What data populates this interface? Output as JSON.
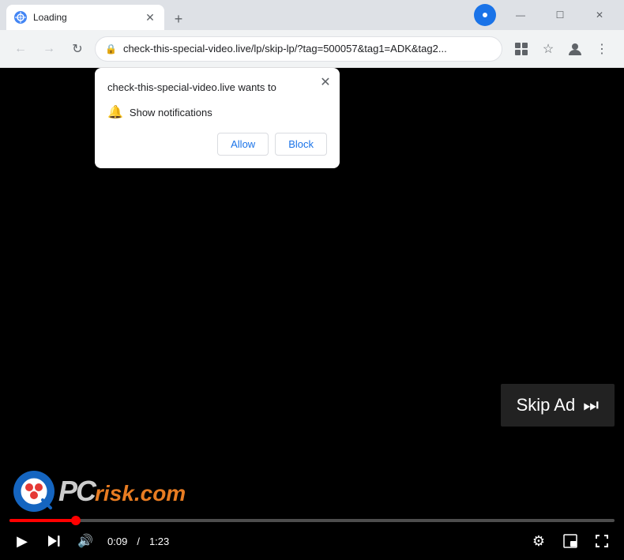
{
  "browser": {
    "tab": {
      "title": "Loading",
      "favicon_label": "loading-favicon"
    },
    "new_tab_label": "+",
    "window_controls": {
      "minimize": "—",
      "maximize": "☐",
      "close": "✕"
    },
    "address_bar": {
      "url": "check-this-special-video.live/lp/skip-lp/?tag=500057&tag1=ADK&tag2...",
      "lock_icon": "🔒"
    },
    "toolbar": {
      "extensions_icon": "⊞",
      "bookmark_icon": "☆",
      "profile_icon": "👤",
      "menu_icon": "⋮"
    }
  },
  "notification_popup": {
    "title": "check-this-special-video.live wants to",
    "notification_row": {
      "icon": "🔔",
      "text": "Show notifications"
    },
    "buttons": {
      "allow": "Allow",
      "block": "Block"
    },
    "close_icon": "✕"
  },
  "video_player": {
    "skip_ad": {
      "label": "Skip Ad",
      "arrow": "⏭"
    },
    "controls": {
      "play_icon": "▶",
      "next_icon": "⏭",
      "volume_icon": "🔊",
      "current_time": "0:09",
      "separator": "/",
      "total_time": "1:23",
      "settings_icon": "⚙",
      "miniplayer_icon": "⬜",
      "fullscreen_icon": "⛶"
    },
    "progress": {
      "filled_percent": 11
    }
  },
  "watermark": {
    "text_pc": "PC",
    "text_risk": "risk.com"
  },
  "colors": {
    "accent": "#1a73e8",
    "progress_red": "#f00",
    "skip_bg": "rgba(40,40,40,0.85)",
    "popup_bg": "#ffffff"
  }
}
